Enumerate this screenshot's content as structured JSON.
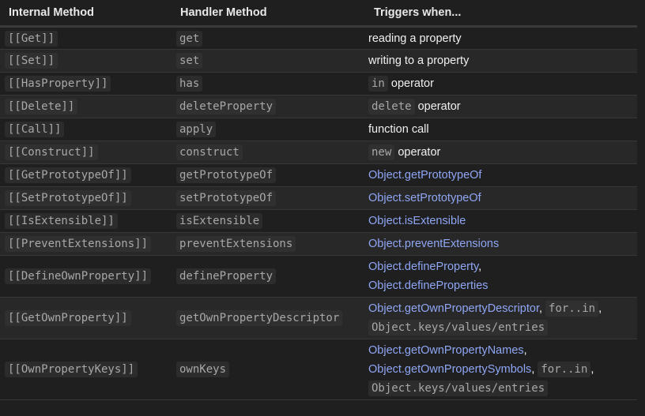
{
  "headers": [
    "Internal Method",
    "Handler Method",
    "Triggers when..."
  ],
  "rows": [
    {
      "internal": "[[Get]]",
      "handler": "get",
      "trigger_text": "reading a property"
    },
    {
      "internal": "[[Set]]",
      "handler": "set",
      "trigger_text": "writing to a property"
    },
    {
      "internal": "[[HasProperty]]",
      "handler": "has",
      "trigger_code": "in",
      "trigger_text": "operator"
    },
    {
      "internal": "[[Delete]]",
      "handler": "deleteProperty",
      "trigger_code": "delete",
      "trigger_text": "operator"
    },
    {
      "internal": "[[Call]]",
      "handler": "apply",
      "trigger_text": "function call"
    },
    {
      "internal": "[[Construct]]",
      "handler": "construct",
      "trigger_code": "new",
      "trigger_text": "operator"
    },
    {
      "internal": "[[GetPrototypeOf]]",
      "handler": "getPrototypeOf",
      "trigger_link": "Object.getPrototypeOf"
    },
    {
      "internal": "[[SetPrototypeOf]]",
      "handler": "setPrototypeOf",
      "trigger_link": "Object.setPrototypeOf"
    },
    {
      "internal": "[[IsExtensible]]",
      "handler": "isExtensible",
      "trigger_link": "Object.isExtensible"
    },
    {
      "internal": "[[PreventExtensions]]",
      "handler": "preventExtensions",
      "trigger_link": "Object.preventExtensions"
    },
    {
      "internal": "[[DefineOwnProperty]]",
      "handler": "defineProperty",
      "trigger_link": "Object.defineProperty",
      "trigger_link2": "Object.defineProperties",
      "sep1": ","
    },
    {
      "internal": "[[GetOwnProperty]]",
      "handler": "getOwnPropertyDescriptor",
      "trigger_link": "Object.getOwnPropertyDescriptor",
      "sep1": ",",
      "trigger_code": "for..in",
      "sep2": ",",
      "trigger_code2": "Object.keys/values/entries"
    },
    {
      "internal": "[[OwnPropertyKeys]]",
      "handler": "ownKeys",
      "trigger_link": "Object.getOwnPropertyNames",
      "sep1": ",",
      "trigger_link2": "Object.getOwnPropertySymbols",
      "sep2": ",",
      "trigger_code": "for..in",
      "sep3": ",",
      "trigger_code2": "Object.keys/values/entries"
    }
  ]
}
